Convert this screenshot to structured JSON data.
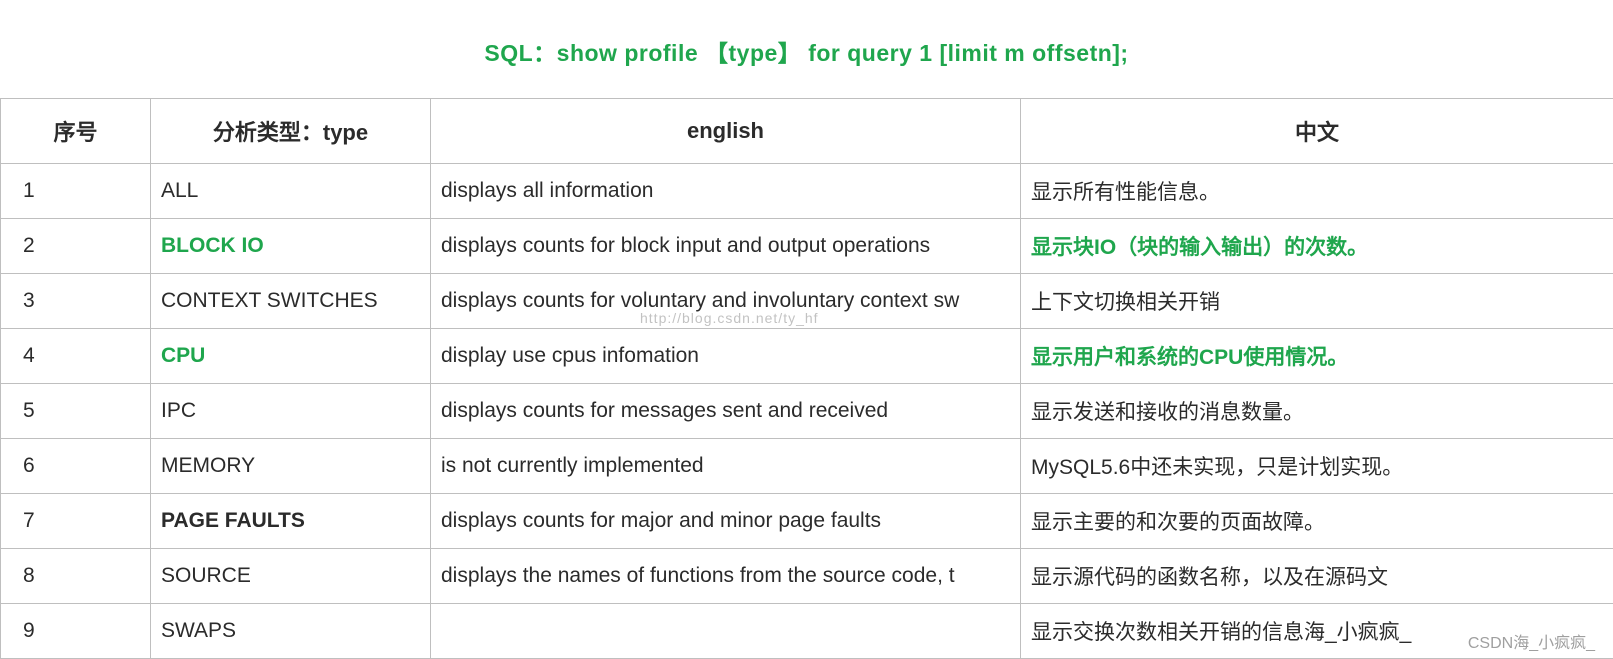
{
  "title": "SQL：show profile 【type】 for query 1 [limit m offsetn];",
  "columns": {
    "seq": "序号",
    "type": "分析类型：type",
    "eng": "english",
    "cn": "中文"
  },
  "rows": [
    {
      "seq": "1",
      "type": "ALL",
      "type_green": false,
      "type_bold": false,
      "eng": "displays all information",
      "cn": "显示所有性能信息。",
      "cn_green": false
    },
    {
      "seq": "2",
      "type": "BLOCK IO",
      "type_green": true,
      "type_bold": true,
      "eng": "displays counts for block input and output operations",
      "cn": "显示块IO（块的输入输出）的次数。",
      "cn_green": true
    },
    {
      "seq": "3",
      "type": "CONTEXT SWITCHES",
      "type_green": false,
      "type_bold": false,
      "eng": "displays counts for voluntary and involuntary context sw",
      "cn": "上下文切换相关开销",
      "cn_green": false
    },
    {
      "seq": "4",
      "type": "CPU",
      "type_green": true,
      "type_bold": true,
      "eng": "display use cpus infomation",
      "cn": "显示用户和系统的CPU使用情况。",
      "cn_green": true
    },
    {
      "seq": "5",
      "type": "IPC",
      "type_green": false,
      "type_bold": false,
      "eng": "displays counts for messages sent and received",
      "cn": "显示发送和接收的消息数量。",
      "cn_green": false
    },
    {
      "seq": "6",
      "type": "MEMORY",
      "type_green": false,
      "type_bold": false,
      "eng": "is not currently implemented",
      "cn": "MySQL5.6中还未实现，只是计划实现。",
      "cn_green": false
    },
    {
      "seq": "7",
      "type": "PAGE FAULTS",
      "type_green": false,
      "type_bold": true,
      "eng": "displays counts for major and minor page faults",
      "cn": "显示主要的和次要的页面故障。",
      "cn_green": false
    },
    {
      "seq": "8",
      "type": "SOURCE",
      "type_green": false,
      "type_bold": false,
      "eng": "displays the names of functions from the source code, t",
      "cn": "显示源代码的函数名称，以及在源码文",
      "cn_green": false
    },
    {
      "seq": "9",
      "type": "SWAPS",
      "type_green": false,
      "type_bold": false,
      "eng": "",
      "cn": "显示交换次数相关开销的信息海_小疯疯_",
      "cn_green": false
    }
  ],
  "watermark_center": "http://blog.csdn.net/ty_hf",
  "watermark_corner": "CSDN海_小疯疯_"
}
